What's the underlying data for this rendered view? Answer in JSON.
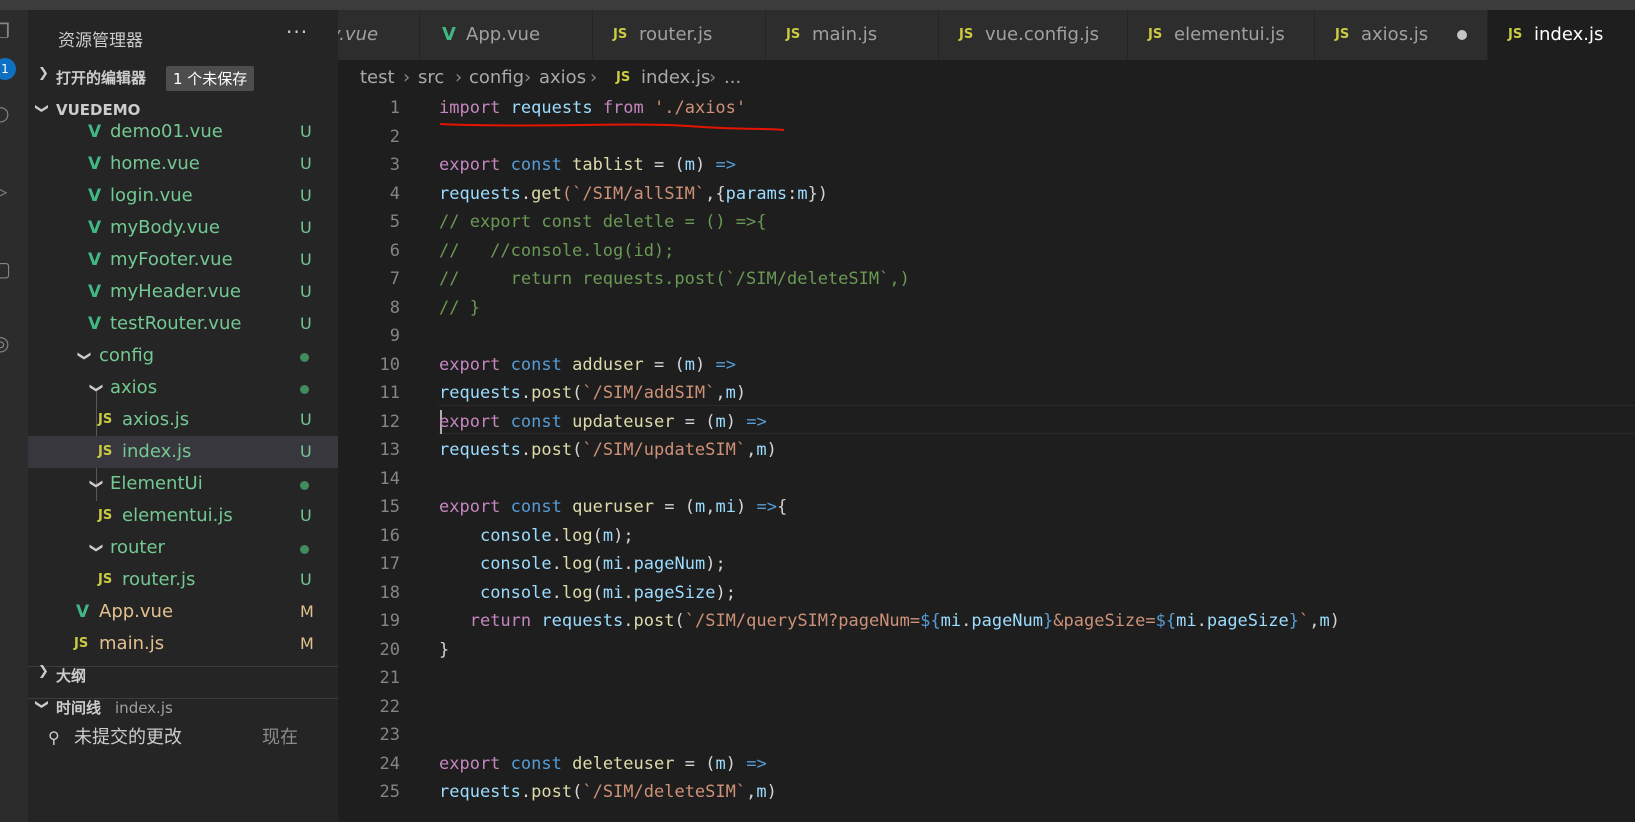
{
  "sidebar": {
    "title": "资源管理器",
    "more": "···",
    "open_editors": {
      "label": "打开的编辑器",
      "unsaved": "1 个未保存"
    },
    "project": "VUEDEMO",
    "files": [
      {
        "name": "demo01.vue",
        "status": "U",
        "type": "vue"
      },
      {
        "name": "home.vue",
        "status": "U",
        "type": "vue"
      },
      {
        "name": "login.vue",
        "status": "U",
        "type": "vue"
      },
      {
        "name": "myBody.vue",
        "status": "U",
        "type": "vue"
      },
      {
        "name": "myFooter.vue",
        "status": "U",
        "type": "vue"
      },
      {
        "name": "myHeader.vue",
        "status": "U",
        "type": "vue"
      },
      {
        "name": "testRouter.vue",
        "status": "U",
        "type": "vue"
      },
      {
        "name": "config",
        "status": "",
        "type": "folder"
      },
      {
        "name": "axios",
        "status": "",
        "type": "folder"
      },
      {
        "name": "axios.js",
        "status": "U",
        "type": "js"
      },
      {
        "name": "index.js",
        "status": "U",
        "type": "js"
      },
      {
        "name": "ElementUi",
        "status": "",
        "type": "folder"
      },
      {
        "name": "elementui.js",
        "status": "U",
        "type": "js"
      },
      {
        "name": "router",
        "status": "",
        "type": "folder"
      },
      {
        "name": "router.js",
        "status": "U",
        "type": "js"
      },
      {
        "name": "App.vue",
        "status": "M",
        "type": "vue"
      },
      {
        "name": "main.js",
        "status": "M",
        "type": "js"
      }
    ],
    "outline": "大纲",
    "timeline": {
      "label": "时间线",
      "file": "index.js",
      "entry": "未提交的更改",
      "when": "现在"
    },
    "badge": "1"
  },
  "tabs": [
    {
      "label": "y.vue",
      "icon": "vue-icon"
    },
    {
      "label": "App.vue",
      "icon": "vue-icon"
    },
    {
      "label": "router.js",
      "icon": "js-icon"
    },
    {
      "label": "main.js",
      "icon": "js-icon"
    },
    {
      "label": "vue.config.js",
      "icon": "js-icon"
    },
    {
      "label": "elementui.js",
      "icon": "js-icon"
    },
    {
      "label": "axios.js",
      "icon": "js-icon"
    },
    {
      "label": "index.js",
      "icon": "js-icon"
    }
  ],
  "js_icon_text": "JS",
  "breadcrumb": [
    "test",
    "src",
    "config",
    "axios",
    "index.js",
    "..."
  ],
  "line_numbers": [
    "1",
    "2",
    "3",
    "4",
    "5",
    "6",
    "7",
    "8",
    "9",
    "10",
    "11",
    "12",
    "13",
    "14",
    "15",
    "16",
    "17",
    "18",
    "19",
    "20",
    "21",
    "22",
    "23",
    "24",
    "25"
  ],
  "code": {
    "l1": [
      "import",
      "requests",
      "from",
      "'./axios'"
    ],
    "l3": [
      "export",
      "const",
      "tablist",
      "=",
      "(",
      "m",
      ")",
      "=>"
    ],
    "l4": [
      "requests",
      ".",
      "get",
      "(`/SIM/allSIM`",
      ",{",
      "params",
      ":",
      "m",
      "})"
    ],
    "l5": "// export const deletle = () =>{",
    "l6": "//   //console.log(id);",
    "l7": "//     return requests.post(`/SIM/deleteSIM`,)",
    "l8": "// }",
    "l10": [
      "export",
      "const",
      "adduser",
      "=",
      "(",
      "m",
      ")",
      "=>"
    ],
    "l11": [
      "requests",
      ".",
      "post",
      "(",
      "`/SIM/addSIM`",
      ",",
      "m",
      ")"
    ],
    "l12": [
      "export",
      "const",
      "updateuser",
      "=",
      "(",
      "m",
      ")",
      "=>"
    ],
    "l13": [
      "requests",
      ".",
      "post",
      "(",
      "`/SIM/updateSIM`",
      ",",
      "m",
      ")"
    ],
    "l15": [
      "export",
      "const",
      "queruser",
      "=",
      "(",
      "m",
      ",",
      "mi",
      ")",
      "=>",
      "{"
    ],
    "l16": [
      "console",
      ".",
      "log",
      "(",
      "m",
      ");"
    ],
    "l17": [
      "console",
      ".",
      "log",
      "(",
      "mi",
      ".",
      "pageNum",
      ");"
    ],
    "l18": [
      "console",
      ".",
      "log",
      "(",
      "mi",
      ".",
      "pageSize",
      ");"
    ],
    "l19": [
      "return",
      "requests",
      ".",
      "post",
      "(",
      "`/SIM/querySIM?pageNum=",
      "${",
      "mi",
      ".",
      "pageNum",
      "}",
      "&pageSize=",
      "${",
      "mi",
      ".",
      "pageSize",
      "}",
      "`",
      ",",
      "m",
      ")"
    ],
    "l20": "}",
    "l24": [
      "export",
      "const",
      "deleteuser",
      "=",
      "(",
      "m",
      ")",
      "=>"
    ],
    "l25": [
      "requests",
      ".",
      "post",
      "(",
      "`/SIM/deleteSIM`",
      ",",
      "m",
      ")"
    ]
  },
  "colors": {
    "keyword": "#c586c0",
    "storage": "#569cd6",
    "variable": "#9cdcfe",
    "function": "#dcdcaa",
    "string": "#ce9178",
    "comment": "#6a9955",
    "annotation": "#e51400"
  }
}
